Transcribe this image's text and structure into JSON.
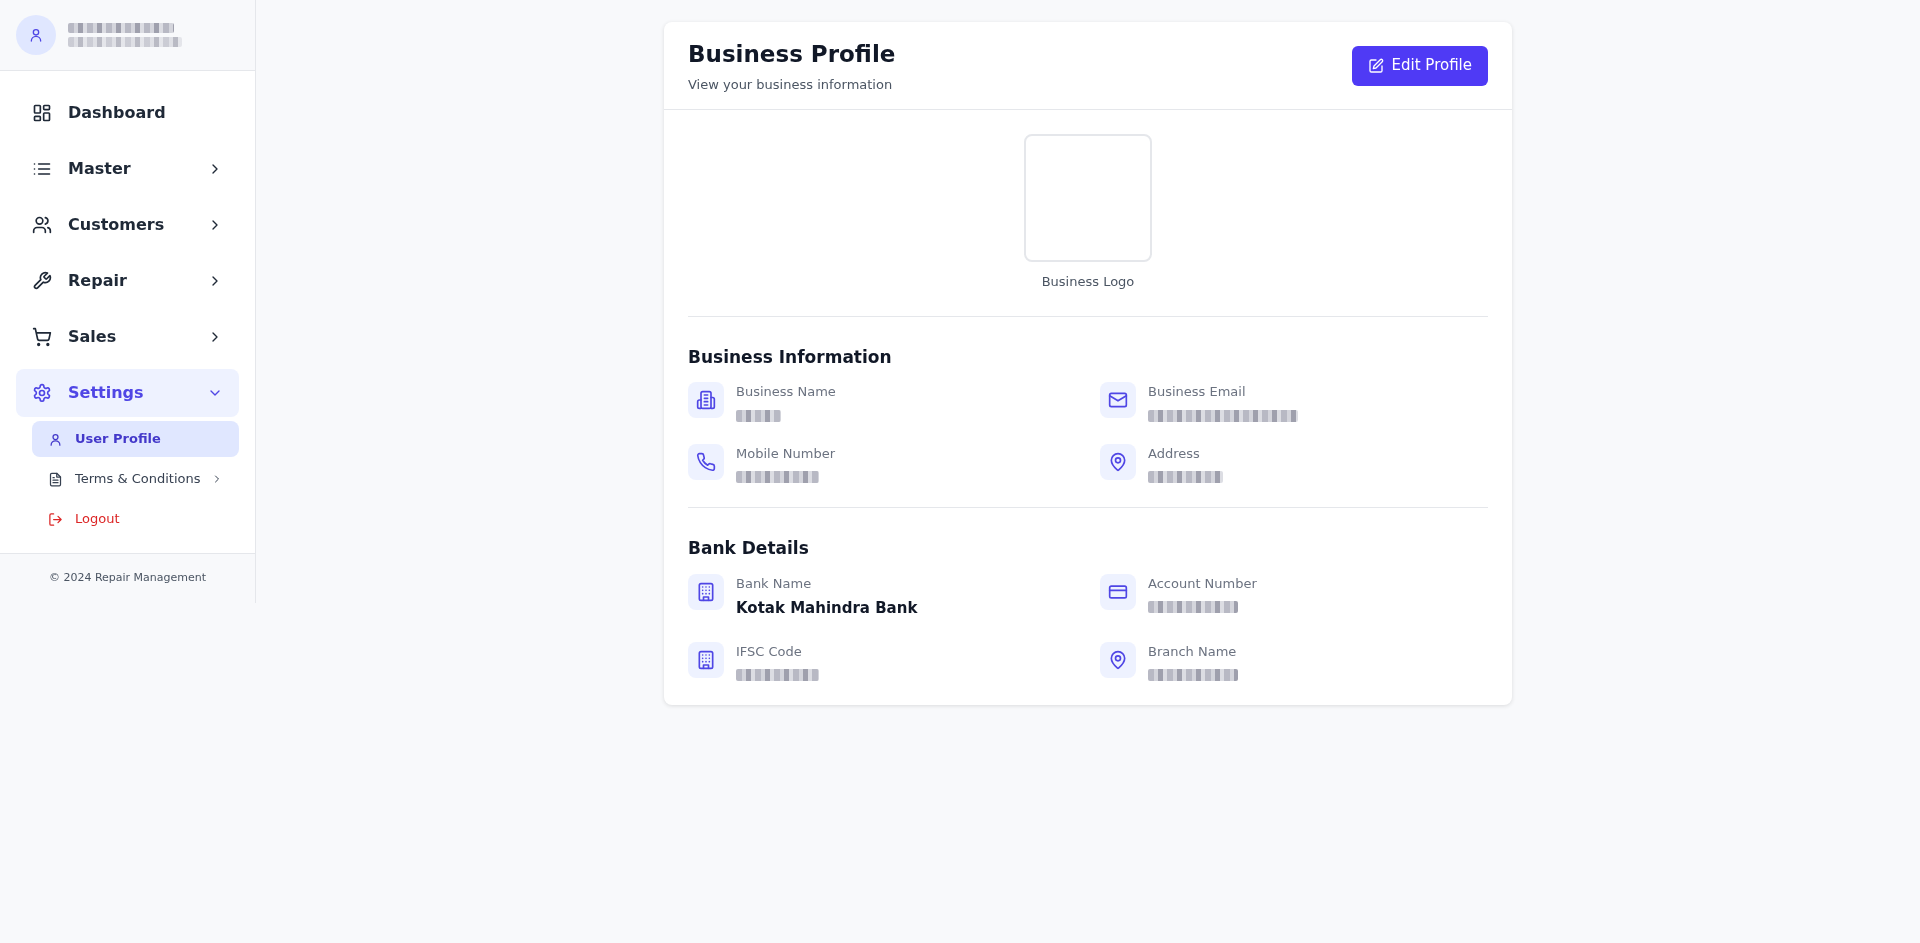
{
  "sidebar": {
    "items": [
      {
        "label": "Dashboard",
        "has_submenu": false,
        "selected": false
      },
      {
        "label": "Master",
        "has_submenu": true,
        "expanded": false,
        "selected": false
      },
      {
        "label": "Customers",
        "has_submenu": true,
        "expanded": false,
        "selected": false
      },
      {
        "label": "Repair",
        "has_submenu": true,
        "expanded": false,
        "selected": false
      },
      {
        "label": "Sales",
        "has_submenu": true,
        "expanded": false,
        "selected": false
      },
      {
        "label": "Settings",
        "has_submenu": true,
        "expanded": true,
        "selected": true,
        "children": [
          {
            "label": "User Profile",
            "kind": "link",
            "has_submenu": false,
            "selected": true
          },
          {
            "label": "Terms & Conditions",
            "kind": "link",
            "has_submenu": true,
            "selected": false
          },
          {
            "label": "Logout",
            "kind": "danger",
            "has_submenu": false,
            "selected": false
          }
        ]
      }
    ],
    "footer": "© 2024 Repair Management"
  },
  "card": {
    "title": "Business Profile",
    "subtitle": "View your business information",
    "edit_button": "Edit Profile",
    "logo_caption": "Business Logo",
    "sections": [
      {
        "title": "Business Information",
        "fields": [
          {
            "label": "Business Name",
            "kind": "redacted"
          },
          {
            "label": "Business Email",
            "kind": "redacted"
          },
          {
            "label": "Mobile Number",
            "kind": "redacted"
          },
          {
            "label": "Address",
            "kind": "redacted"
          }
        ]
      },
      {
        "title": "Bank Details",
        "fields": [
          {
            "label": "Bank Name",
            "kind": "text",
            "value": "Kotak Mahindra Bank"
          },
          {
            "label": "Account Number",
            "kind": "redacted"
          },
          {
            "label": "IFSC Code",
            "kind": "redacted"
          },
          {
            "label": "Branch Name",
            "kind": "redacted"
          }
        ]
      }
    ]
  }
}
